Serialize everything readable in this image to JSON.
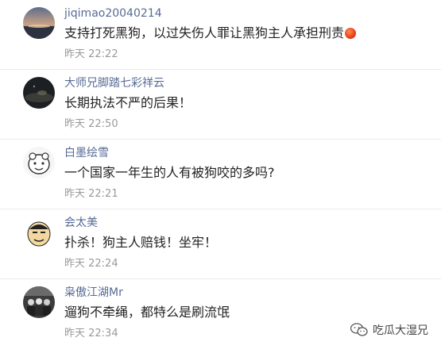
{
  "comments": [
    {
      "username": "jiqimao20040214",
      "text": "支持打死黑狗，以过失伤人罪让黑狗主人承担刑责",
      "time": "昨天 22:22",
      "emoji": "red-ball-emoji"
    },
    {
      "username": "大师兄脚踏七彩祥云",
      "text": "长期执法不严的后果！",
      "time": "昨天 22:50"
    },
    {
      "username": "白墨绘雪",
      "text": "一个国家一年生的人有被狗咬的多吗?",
      "time": "昨天 22:21"
    },
    {
      "username": "会太美",
      "text": "扑杀！狗主人赔钱！坐牢！",
      "time": "昨天 22:24"
    },
    {
      "username": "枭傲江湖Mr",
      "text": "遛狗不牵绳，都特么是刷流氓",
      "time": "昨天 22:34"
    }
  ],
  "watermark": {
    "text": "吃瓜大湿兄",
    "icon": "wechat-icon"
  },
  "colors": {
    "username": "#576b95",
    "text": "#222222",
    "time": "#9a9a9a",
    "divider": "#ebebeb"
  }
}
